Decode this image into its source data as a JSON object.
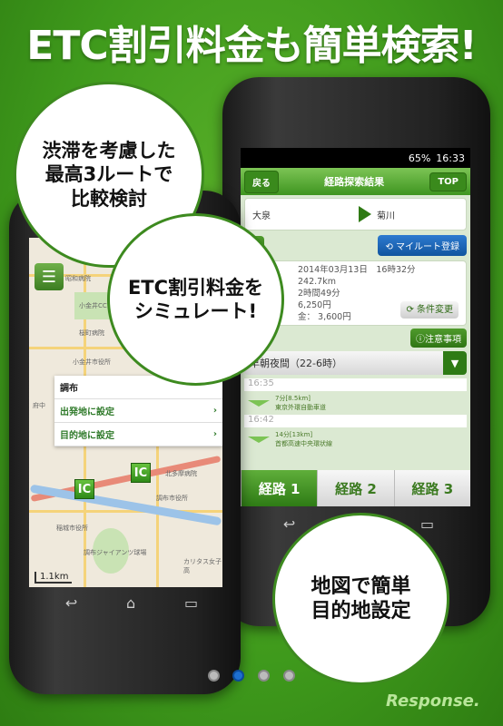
{
  "headline": "ETC割引料金も簡単検索!",
  "right_phone": {
    "status": {
      "time": "16:33",
      "battery": "65%"
    },
    "header": {
      "back": "戻る",
      "title": "経路探索結果",
      "top": "TOP"
    },
    "route": {
      "from": "大泉",
      "to": "菊川"
    },
    "map_button": "図",
    "myroute_button": "マイルート登録",
    "details": {
      "datetime": "2014年03月13日　16時32分",
      "distance": "242.7km",
      "duration": "2時間49分",
      "toll": "6,250円",
      "etc_toll": "金： 3,600円"
    },
    "change_button": "条件変更",
    "notice_button": "注意事項",
    "time_select": "早朝夜間（22-6時）",
    "segments": [
      {
        "time": "16:35",
        "info": "7分[8.5km]",
        "road": "東京外環自動車道"
      },
      {
        "time": "16:42",
        "info": "14分[13km]",
        "road": "首都高速中央環状線"
      }
    ],
    "tabs": [
      "経路 1",
      "経路 2",
      "経路 3"
    ],
    "active_tab": 0
  },
  "left_phone": {
    "map_labels": [
      "昭和病院",
      "小金井CC",
      "桜町病院",
      "小金井市役所",
      "北多摩病院",
      "調布市役所",
      "稲城市役所",
      "府中",
      "調布ジャイアンツ球場",
      "カリタス女子高"
    ],
    "popup": {
      "title": "調布",
      "set_origin": "出発地に設定",
      "set_destination": "目的地に設定"
    },
    "ic_label": "IC",
    "scale": "1.1km"
  },
  "bubbles": {
    "b1": [
      "渋滞を考慮した",
      "最高3ルートで",
      "比較検討"
    ],
    "b2": [
      "ETC割引料金を",
      "シミュレート!"
    ],
    "b3": [
      "地図で簡単",
      "目的地設定"
    ]
  },
  "pager": {
    "count": 4,
    "active": 1
  },
  "logo": "Response.",
  "colors": {
    "background": "#3f9a1c",
    "accent": "#3d8a1f",
    "active_dot": "#1e6fd0"
  }
}
